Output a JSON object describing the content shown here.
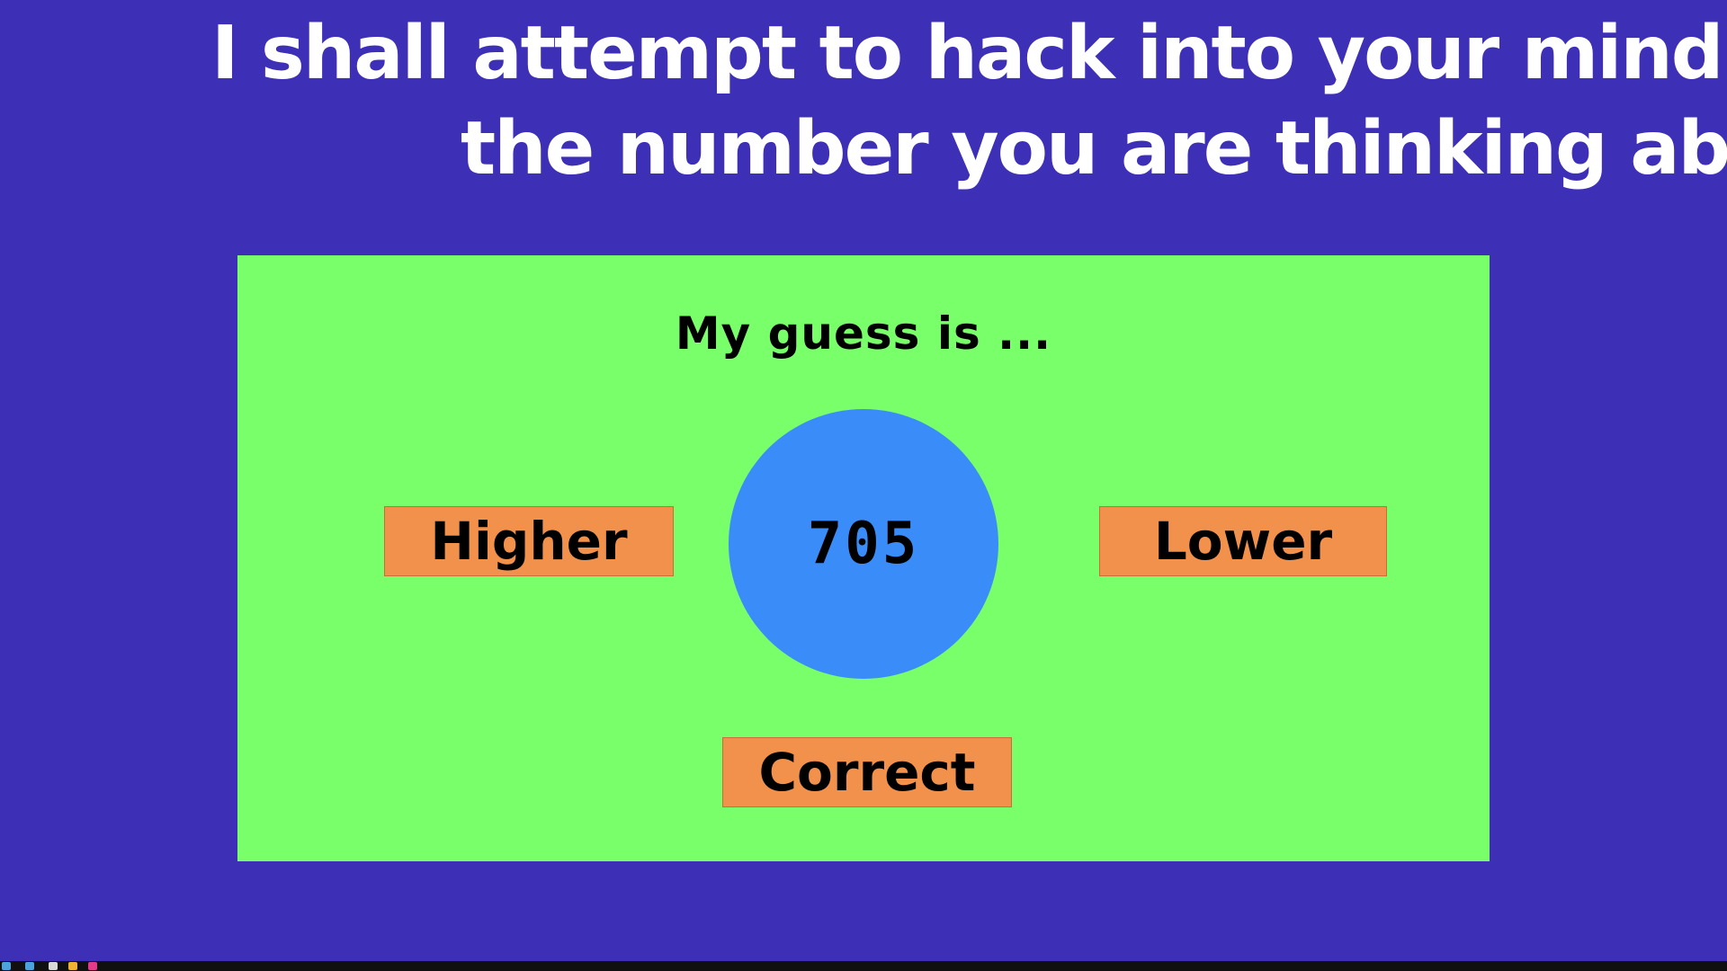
{
  "headline": {
    "line1": "I shall attempt to hack into your mind and guess",
    "line2": "the number you are thinking about!"
  },
  "game": {
    "prompt": "My guess is ...",
    "guess": "705",
    "buttons": {
      "higher": "Higher",
      "lower": "Lower",
      "correct": "Correct"
    }
  },
  "colors": {
    "background": "#3d2fb6",
    "panel": "#78ff69",
    "guess_circle": "#3a8df8",
    "button": "#f2914c",
    "text_dark": "#000000",
    "text_light": "#ffffff"
  },
  "icons": {
    "taskbar": [
      "terminal-icon",
      "files-icon",
      "browser-icon",
      "app-icon"
    ]
  }
}
